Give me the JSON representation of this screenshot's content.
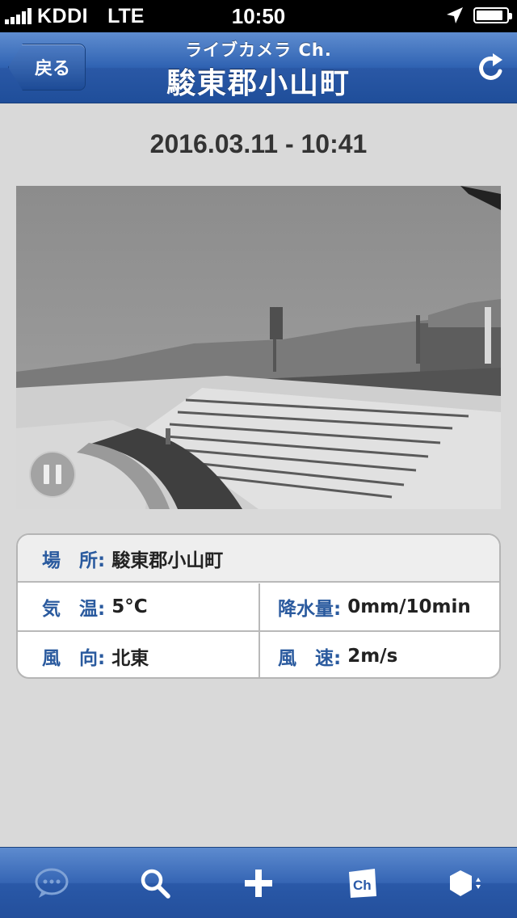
{
  "status_bar": {
    "carrier": "KDDI",
    "network": "LTE",
    "time": "10:50",
    "icons": [
      "signal-icon",
      "location-arrow-icon",
      "battery-icon"
    ]
  },
  "nav": {
    "back_label": "戻る",
    "subtitle": "ライブカメラ Ch.",
    "title": "駿東郡小山町",
    "refresh_icon": "refresh-icon"
  },
  "timestamp": "2016.03.11 - 10:41",
  "camera": {
    "pause_icon": "pause-icon"
  },
  "info": {
    "location_label": "場　所:",
    "location_value": "駿東郡小山町",
    "temp_label": "気　温:",
    "temp_value": "5°C",
    "precip_label": "降水量:",
    "precip_value": "0mm/10min",
    "wind_dir_label": "風　向:",
    "wind_dir_value": "北東",
    "wind_speed_label": "風　速:",
    "wind_speed_value": "2m/s"
  },
  "tabbar": {
    "items": [
      "chat-icon",
      "search-icon",
      "add-icon",
      "channel-icon",
      "settings-hexagon-icon"
    ]
  },
  "colors": {
    "nav_blue": "#2f62b2",
    "label_blue": "#2a5a9e",
    "background": "#d9d9d9"
  }
}
